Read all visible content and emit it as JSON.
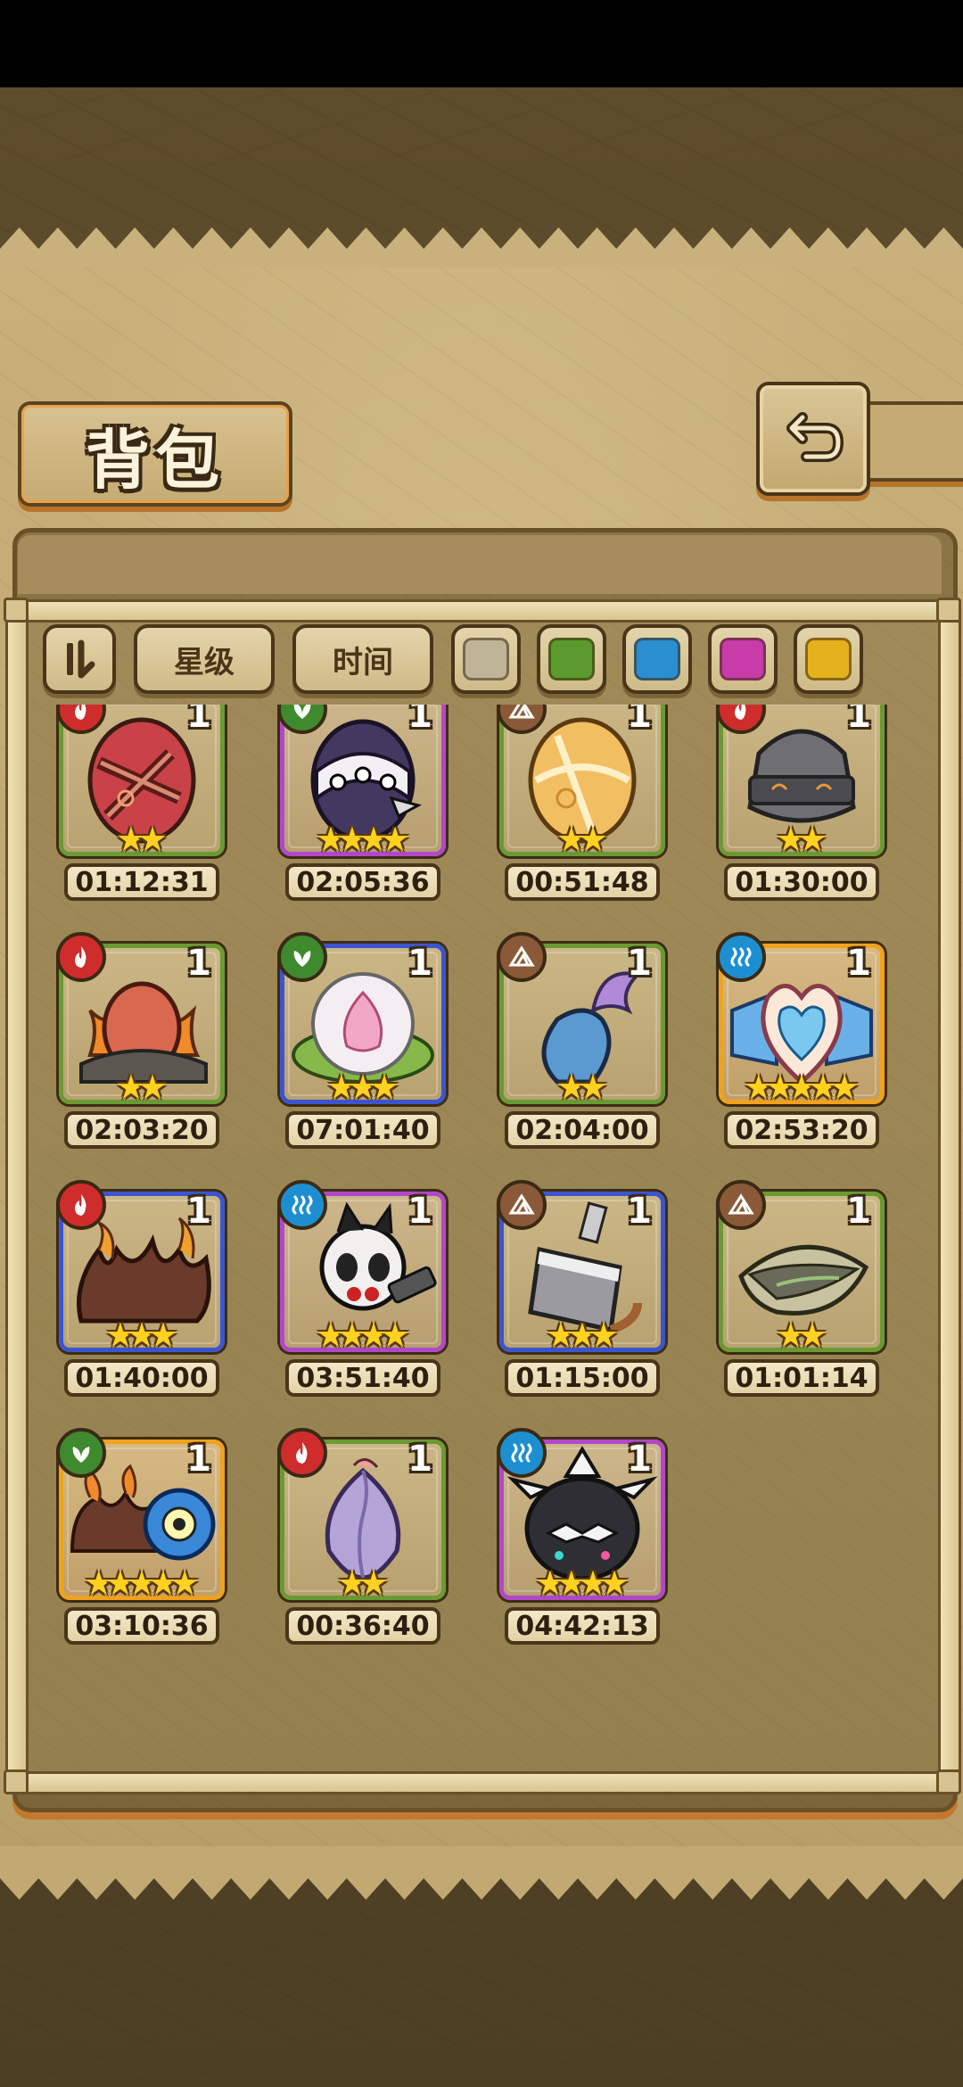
{
  "header": {
    "title": "背包"
  },
  "toolbar": {
    "sort_star": "星级",
    "sort_time": "时间",
    "filters": [
      {
        "color": "#bfb497"
      },
      {
        "color": "#5b9a2c"
      },
      {
        "color": "#2a8fd0"
      },
      {
        "color": "#c73ca9"
      },
      {
        "color": "#e5b21e"
      }
    ]
  },
  "items": [
    {
      "element": "fire",
      "rarity": "green",
      "count": "1",
      "stars": 2,
      "time": "01:12:31",
      "icon": "red-striped-egg"
    },
    {
      "element": "leaf",
      "rarity": "purple",
      "count": "1",
      "stars": 4,
      "time": "02:05:36",
      "icon": "spiked-collar-egg"
    },
    {
      "element": "earth",
      "rarity": "green",
      "count": "1",
      "stars": 2,
      "time": "00:51:48",
      "icon": "golden-swirl-egg"
    },
    {
      "element": "fire",
      "rarity": "green",
      "count": "1",
      "stars": 2,
      "time": "01:30:00",
      "icon": "stone-helmet-egg"
    },
    {
      "element": "fire",
      "rarity": "green",
      "count": "1",
      "stars": 2,
      "time": "02:03:20",
      "icon": "burning-rock-egg"
    },
    {
      "element": "leaf",
      "rarity": "blue",
      "count": "1",
      "stars": 3,
      "time": "07:01:40",
      "icon": "lotus-bubble-egg"
    },
    {
      "element": "earth",
      "rarity": "green",
      "count": "1",
      "stars": 2,
      "time": "02:04:00",
      "icon": "fish-tail-egg"
    },
    {
      "element": "water",
      "rarity": "orange",
      "count": "1",
      "stars": 5,
      "time": "02:53:20",
      "icon": "winged-heart-egg"
    },
    {
      "element": "fire",
      "rarity": "blue",
      "count": "1",
      "stars": 3,
      "time": "01:40:00",
      "icon": "flame-fur-egg"
    },
    {
      "element": "water",
      "rarity": "purple",
      "count": "1",
      "stars": 4,
      "time": "03:51:40",
      "icon": "panda-robot-egg"
    },
    {
      "element": "earth",
      "rarity": "blue",
      "count": "1",
      "stars": 3,
      "time": "01:15:00",
      "icon": "cleaver-egg"
    },
    {
      "element": "earth",
      "rarity": "green",
      "count": "1",
      "stars": 2,
      "time": "01:01:14",
      "icon": "seed-pod-egg"
    },
    {
      "element": "leaf",
      "rarity": "orange",
      "count": "1",
      "stars": 5,
      "time": "03:10:36",
      "icon": "one-eye-beast-egg"
    },
    {
      "element": "fire",
      "rarity": "green",
      "count": "1",
      "stars": 2,
      "time": "00:36:40",
      "icon": "lavender-bud-egg"
    },
    {
      "element": "water",
      "rarity": "purple",
      "count": "1",
      "stars": 4,
      "time": "04:42:13",
      "icon": "spiked-orca-egg"
    }
  ]
}
